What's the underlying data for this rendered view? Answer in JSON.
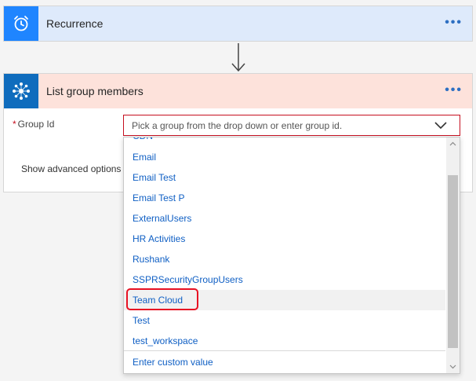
{
  "recurrence": {
    "title": "Recurrence",
    "more_label": "•••"
  },
  "list_members": {
    "title": "List group members",
    "more_label": "•••",
    "field_label": "Group Id",
    "required_marker": "*",
    "placeholder": "Pick a group from the drop down or enter group id.",
    "advanced_label": "Show advanced options"
  },
  "dropdown": {
    "options": [
      "CDN",
      "Email",
      "Email Test",
      "Email Test P",
      "ExternalUsers",
      "HR Activities",
      "Rushank",
      "SSPRSecurityGroupUsers",
      "Team Cloud",
      "Test",
      "test_workspace"
    ],
    "custom_label": "Enter custom value",
    "selected": "Team Cloud"
  },
  "colors": {
    "recurrence_header": "#deeafb",
    "recurrence_icon_bg": "#1f85ff",
    "list_header": "#fde2db",
    "list_icon_bg": "#0f6cbd",
    "link_text": "#0f5fc4",
    "highlight": "#e81123"
  },
  "icons": {
    "recurrence": "alarm-clock-icon",
    "list": "azure-ad-icon",
    "more": "more-dots-icon",
    "dropdown": "chevron-down-icon"
  }
}
